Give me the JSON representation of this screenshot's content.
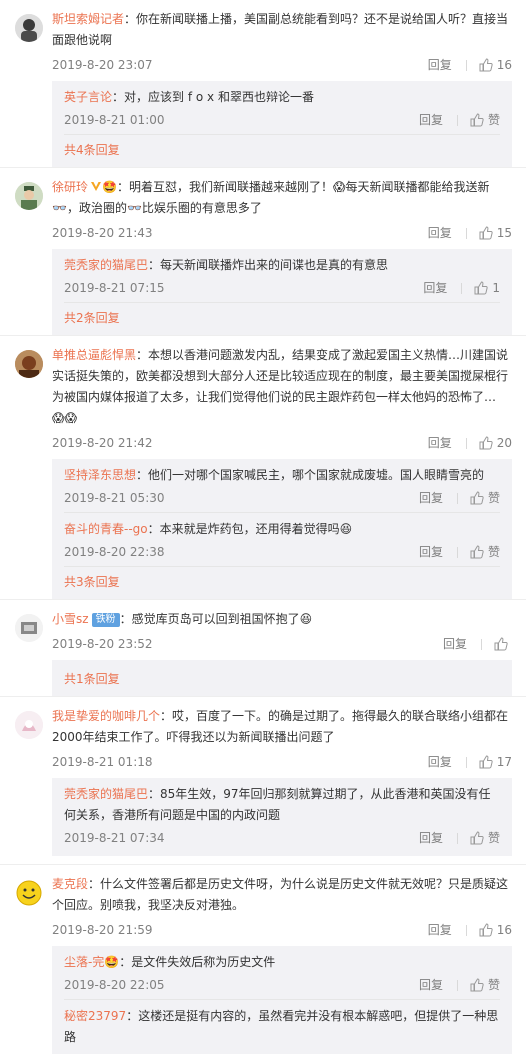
{
  "ui": {
    "reply": "回复",
    "like": "赞"
  },
  "comments": [
    {
      "user": "斯坦索姆记者",
      "text": "：你在新闻联播上播，美国副总统能看到吗？还不是说给国人听？直接当面跟他说啊",
      "time": "2019-8-20 23:07",
      "likes": "16",
      "replies": [
        {
          "user": "英子言论",
          "text": "：对，应该到 f o x 和翠西也辩论一番",
          "time": "2019-8-21 01:00"
        }
      ],
      "more": "共4条回复"
    },
    {
      "user": "徐研玲",
      "text_a": "：明着互怼，我们新闻联播越来越刚了！",
      "text_b": "每天新闻联播都能给我送新",
      "text_c": "，政治圈的",
      "text_d": "比娱乐圈的有意思多了",
      "time": "2019-8-20 21:43",
      "likes": "15",
      "replies": [
        {
          "user": "莞秃家的猫尾巴",
          "text": "：每天新闻联播炸出来的间谍也是真的有意思",
          "time": "2019-8-21 07:15",
          "likes": "1"
        }
      ],
      "more": "共2条回复"
    },
    {
      "user": "单推总逼彪悍黑",
      "text": "：本想以香港问题激发内乱，结果变成了激起爱国主义热情…川建国说实话挺失策的，欧美都没想到大部分人还是比较适应现在的制度，最主要美国搅屎棍行为被国内媒体报道了太多，让我们觉得他们说的民主跟炸药包一样太他妈的恐怖了…",
      "time": "2019-8-20 21:42",
      "likes": "20",
      "replies": [
        {
          "user": "坚持泽东思想",
          "text": "：他们一对哪个国家喊民主，哪个国家就成废墟。国人眼睛雪亮的",
          "time": "2019-8-21 05:30"
        },
        {
          "user": "奋斗的青春--go",
          "text": "：本来就是炸药包，还用得着觉得吗",
          "time": "2019-8-20 22:38"
        }
      ],
      "more": "共3条回复"
    },
    {
      "user": "小雪sz",
      "badge": "铁粉",
      "text": "：感觉库页岛可以回到祖国怀抱了",
      "time": "2019-8-20 23:52",
      "likes": "",
      "replies": [],
      "more": "共1条回复"
    },
    {
      "user": "我是挚爱的咖啡几个",
      "text": "：哎，百度了一下。的确是过期了。拖得最久的联合联络小组都在2000年结束工作了。吓得我还以为新闻联播出问题了",
      "time": "2019-8-21 01:18",
      "likes": "17",
      "replies": [
        {
          "user": "莞秃家的猫尾巴",
          "text": "：85年生效，97年回归那刻就算过期了，从此香港和英国没有任何关系，香港所有问题是中国的内政问题",
          "time": "2019-8-21 07:34"
        }
      ]
    },
    {
      "user": "麦克段",
      "text": "：什么文件签署后都是历史文件呀，为什么说是历史文件就无效呢？只是质疑这个回应。别喷我，我坚决反对港独。",
      "time": "2019-8-20 21:59",
      "likes": "16",
      "replies": [
        {
          "user": "尘落-完",
          "text": "：是文件失效后称为历史文件",
          "time": "2019-8-20 22:05"
        },
        {
          "user": "秘密23797",
          "text": "：这楼还是挺有内容的，虽然看完并没有根本解惑吧，但提供了一种思路"
        }
      ]
    }
  ]
}
